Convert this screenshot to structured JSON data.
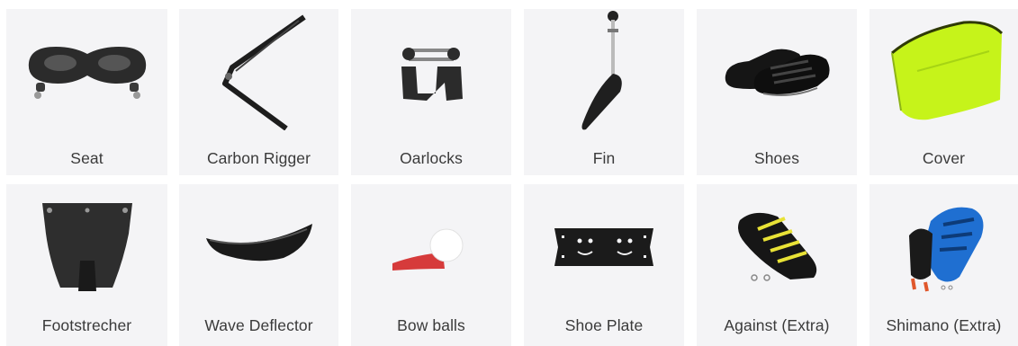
{
  "products": [
    {
      "label": "Seat",
      "icon": "seat-icon"
    },
    {
      "label": "Carbon Rigger",
      "icon": "carbon-rigger-icon"
    },
    {
      "label": "Oarlocks",
      "icon": "oarlocks-icon"
    },
    {
      "label": "Fin",
      "icon": "fin-icon"
    },
    {
      "label": "Shoes",
      "icon": "shoes-icon"
    },
    {
      "label": "Cover",
      "icon": "cover-icon"
    },
    {
      "label": "Footstrecher",
      "icon": "footstretcher-icon"
    },
    {
      "label": "Wave Deflector",
      "icon": "wave-deflector-icon"
    },
    {
      "label": "Bow balls",
      "icon": "bow-balls-icon"
    },
    {
      "label": "Shoe Plate",
      "icon": "shoe-plate-icon"
    },
    {
      "label": "Against (Extra)",
      "icon": "against-shoes-icon"
    },
    {
      "label": "Shimano (Extra)",
      "icon": "shimano-shoes-icon"
    }
  ],
  "colors": {
    "tile_bg": "#f4f4f6",
    "label_text": "#3a3a3a",
    "cover_green": "#c6f31a",
    "shimano_blue": "#1f6fd1",
    "against_yellow": "#e8e236",
    "bow_ball_red": "#d63b3b"
  }
}
